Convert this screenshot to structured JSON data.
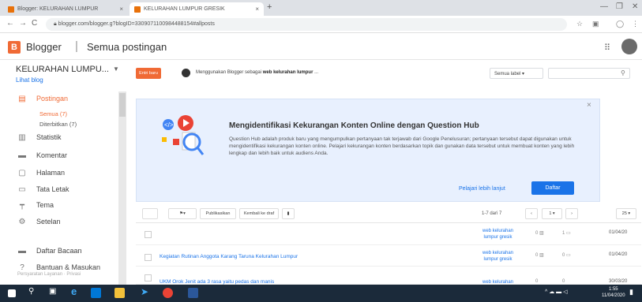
{
  "browser": {
    "tabs": [
      {
        "title": "Blogger: KELURAHAN LUMPUR"
      },
      {
        "title": "KELURAHAN LUMPUR GRESIK"
      }
    ],
    "url": "blogger.com/blogger.g?blogID=3309071100984488154#allposts"
  },
  "header": {
    "app_name": "Blogger",
    "page_title": "Semua postingan"
  },
  "sidebar": {
    "blog_name": "KELURAHAN LUMPU...",
    "view_blog": "Lihat blog",
    "items": [
      {
        "label": "Postingan",
        "icon": "posts-icon",
        "active": true
      },
      {
        "label": "Statistik",
        "icon": "stats-icon"
      },
      {
        "label": "Komentar",
        "icon": "comment-icon"
      },
      {
        "label": "Halaman",
        "icon": "page-icon"
      },
      {
        "label": "Tata Letak",
        "icon": "layout-icon"
      },
      {
        "label": "Tema",
        "icon": "theme-icon"
      },
      {
        "label": "Setelan",
        "icon": "gear-icon"
      },
      {
        "label": "Daftar Bacaan",
        "icon": "reading-list-icon"
      },
      {
        "label": "Bantuan & Masukan",
        "icon": "help-icon"
      }
    ],
    "sub_items": [
      "Semua (7)",
      "Diterbitkan (7)"
    ],
    "footer": "Persyaratan Layanan · Privasi"
  },
  "toolbar": {
    "new_post": "Entri baru",
    "using_text_prefix": "Menggunakan Blogger sebagai ",
    "using_text_bold": "web kelurahan lumpur",
    "using_text_suffix": " ...",
    "label_select": "Semua label",
    "search_placeholder": ""
  },
  "card": {
    "title": "Mengidentifikasi Kekurangan Konten Online dengan Question Hub",
    "body": "Question Hub adalah produk baru yang mengumpulkan pertanyaan tak terjawab dari Google Penelusuran; pertanyaan tersebut dapat digunakan untuk mengidentifikasi kekurangan konten online. Pelajari kekurangan konten berdasarkan topik dan gunakan data tersebut untuk membuat konten yang lebih lengkap dan lebih baik untuk audiens Anda.",
    "learn_more": "Pelajari lebih lanjut",
    "register": "Daftar"
  },
  "list_toolbar": {
    "publish": "Publikasikan",
    "revert": "Kembali ke draf",
    "page_count": "1-7 dari 7",
    "per_page": "25"
  },
  "posts": [
    {
      "title": "",
      "label": "web kelurahan lumpur gresik",
      "views": "0",
      "comments": "1",
      "date": "01/04/20"
    },
    {
      "title": "Kegiatan Rutinan Anggota Karang Taruna Kelurahan Lumpur",
      "label": "web kelurahan lumpur gresik",
      "views": "0",
      "comments": "0",
      "date": "01/04/20"
    },
    {
      "title": "UKM Orok Jenit ada 3 rasa yaitu pedas dan manis",
      "label": "web kelurahan",
      "views": "0",
      "comments": "0",
      "date": "30/03/20"
    }
  ],
  "taskbar": {
    "time": "1:55",
    "date": "11/04/2020"
  },
  "colors": {
    "accent": "#f06a35",
    "link": "#1a73e8",
    "card_bg": "#e8f0fe",
    "taskbar": "#1b2a3a"
  }
}
